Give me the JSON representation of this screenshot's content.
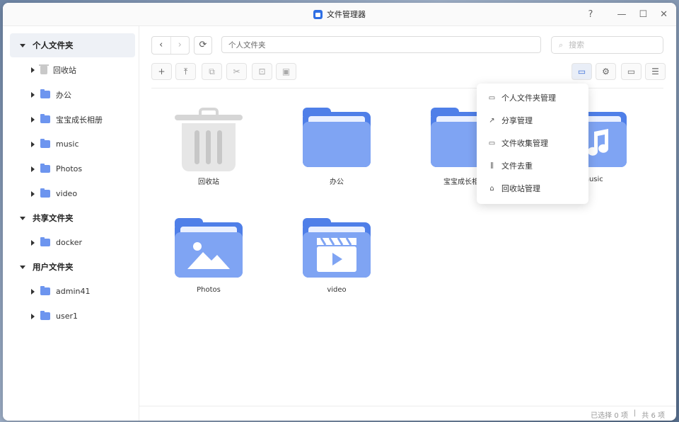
{
  "window": {
    "title": "文件管理器"
  },
  "controls": {
    "help": "?",
    "minimize": "—",
    "maximize": "☐",
    "close": "✕"
  },
  "sidebar": {
    "groups": [
      {
        "label": "个人文件夹",
        "items": [
          "回收站",
          "办公",
          "宝宝成长相册",
          "music",
          "Photos",
          "video"
        ]
      },
      {
        "label": "共享文件夹",
        "items": [
          "docker"
        ]
      },
      {
        "label": "用户文件夹",
        "items": [
          "admin41",
          "user1"
        ]
      }
    ]
  },
  "nav": {
    "back": "‹",
    "forward": "›",
    "refresh": "⟳"
  },
  "path": {
    "value": "个人文件夹"
  },
  "search": {
    "placeholder": "搜索"
  },
  "toolbar": {
    "new": "+",
    "upload": "⤒",
    "copy": "⧉",
    "cut": "✂",
    "compress": "⊡",
    "paste": "▣",
    "manage": "▭",
    "settings": "⚙",
    "view": "▭",
    "sort": "☰"
  },
  "files": [
    {
      "name": "回收站",
      "icon": "trash-icon"
    },
    {
      "name": "办公",
      "icon": "folder-icon"
    },
    {
      "name": "宝宝成长相册",
      "icon": "folder-icon"
    },
    {
      "name": "music",
      "icon": "music-folder-icon"
    },
    {
      "name": "Photos",
      "icon": "photo-folder-icon"
    },
    {
      "name": "video",
      "icon": "video-folder-icon"
    }
  ],
  "menu": {
    "items": [
      "个人文件夹管理",
      "分享管理",
      "文件收集管理",
      "文件去重",
      "回收站管理"
    ]
  },
  "status": {
    "selected": "已选择 0 项",
    "separator": "|",
    "total": "共 6 项"
  },
  "colors": {
    "accent": "#2f6fe4",
    "folder_back": "#4f7fe8",
    "folder_front": "#7fa4f3"
  }
}
